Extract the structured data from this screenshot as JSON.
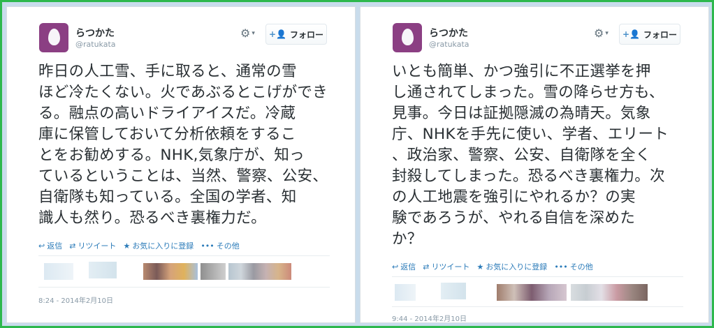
{
  "tweets": [
    {
      "author": {
        "name": "らつかた",
        "handle": "@ratukata"
      },
      "follow_label": "フォロー",
      "text": "昨日の人工雪、手に取ると、通常の雪\nほど冷たくない。火であぶるとこげができ\nる。融点の高いドライアイスだ。冷蔵\n庫に保管しておいて分析依頼をするこ\nとをお勧めする。NHK,気象庁が、知っ\nているということは、当然、警察、公安、\n自衛隊も知っている。全国の学者、知\n識人も然り。恐るべき裏権力だ。",
      "actions": {
        "reply": "返信",
        "retweet": "リツイート",
        "favorite": "お気に入りに登録",
        "more": "その他"
      },
      "timestamp": "8:24 - 2014年2月10日"
    },
    {
      "author": {
        "name": "らつかた",
        "handle": "@ratukata"
      },
      "follow_label": "フォロー",
      "text": "いとも簡単、かつ強引に不正選挙を押\nし通されてしまった。雪の降らせ方も、\n見事。今日は証拠隠滅の為晴天。気象\n庁、NHKを手先に使い、学者、エリート\n、政治家、警察、公安、自衛隊を全く\n封殺してしまった。恐るべき裏権力。次\nの人工地震を強引にやれるか？の実\n験であろうが、やれる自信を深めた\nか？",
      "actions": {
        "reply": "返信",
        "retweet": "リツイート",
        "favorite": "お気に入りに登録",
        "more": "その他"
      },
      "timestamp": "9:44 - 2014年2月10日"
    }
  ],
  "icons": {
    "avatar": "egg-avatar-icon",
    "settings": "gear-icon",
    "follow": "person-plus-icon",
    "reply": "reply-arrow-icon",
    "retweet": "retweet-icon",
    "favorite": "star-icon",
    "more": "dots-icon"
  },
  "colors": {
    "frame": "#2db84d",
    "background": "#c9dcec",
    "link": "#2b7bb9",
    "avatar": "#8b3f83"
  }
}
